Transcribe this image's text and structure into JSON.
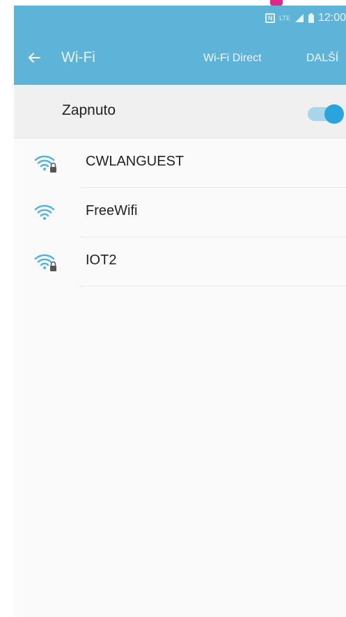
{
  "status_bar": {
    "nfc": "N",
    "lte": "LTE",
    "time": "12:00"
  },
  "app_bar": {
    "title": "Wi-Fi",
    "actions": {
      "wifi_direct": "Wi-Fi Direct",
      "more": "DALŠÍ"
    }
  },
  "master_switch": {
    "label": "Zapnuto",
    "state": "on"
  },
  "networks": [
    {
      "ssid": "CWLANGUEST",
      "secured": true
    },
    {
      "ssid": "FreeWifi",
      "secured": false
    },
    {
      "ssid": "IOT2",
      "secured": true
    }
  ],
  "colors": {
    "accent": "#5eb3d8",
    "toggle_thumb": "#29a4dc",
    "wifi_icon": "#4fb3dd"
  }
}
